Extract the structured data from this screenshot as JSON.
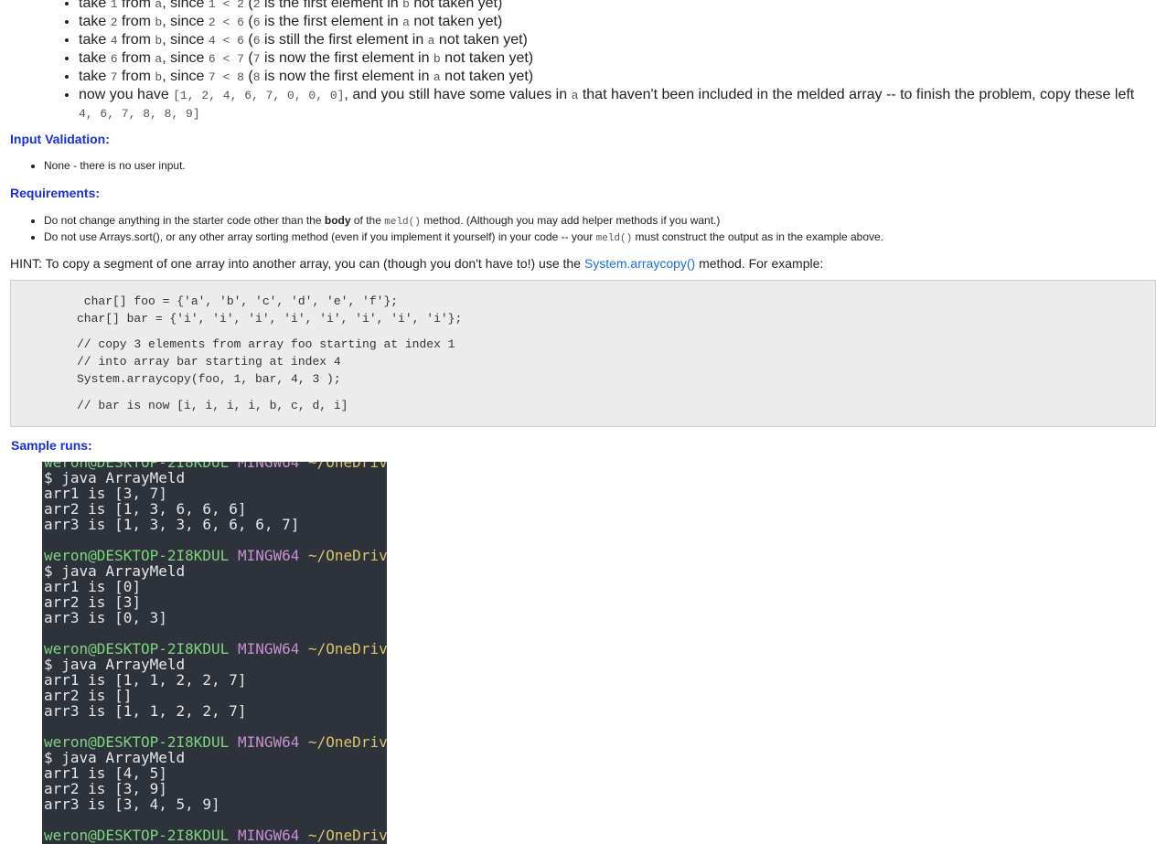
{
  "steps": [
    {
      "a": "take ",
      "c1": "1",
      "b": " from ",
      "c2": "a",
      "d": ", since ",
      "c3": "1 < 2",
      "e": " (",
      "c4": "2",
      "f": " is the first element in ",
      "c5": "b",
      "g": "  not taken yet)"
    },
    {
      "a": "take ",
      "c1": "2",
      "b": " from ",
      "c2": "b",
      "d": ", since ",
      "c3": "2 < 6",
      "e": " (",
      "c4": "6",
      "f": " is the first element in ",
      "c5": "a",
      "g": "  not taken yet)"
    },
    {
      "a": "take ",
      "c1": "4",
      "b": " from ",
      "c2": "b",
      "d": ", since ",
      "c3": "4 < 6",
      "e": " (",
      "c4": "6",
      "f": " is still the first element in ",
      "c5": "a",
      "g": " not taken yet)"
    },
    {
      "a": "take ",
      "c1": "6",
      "b": " from ",
      "c2": "a",
      "d": ", since ",
      "c3": "6 < 7",
      "e": " (",
      "c4": "7",
      "f": " is now the first element in ",
      "c5": "b",
      "g": "  not taken yet)"
    },
    {
      "a": "take ",
      "c1": "7",
      "b": " from ",
      "c2": "b",
      "d": ", since ",
      "c3": "7 < 8",
      "e": " (",
      "c4": "8",
      "f": " is now the first element in ",
      "c5": "a",
      "g": "  not taken yet)"
    }
  ],
  "final_step": {
    "a": "now you have ",
    "code1": "[1, 2, 4, 6, 7, 0, 0, 0]",
    "b": ", and you still have some values in ",
    "code2": "a",
    "c": "  that haven't been included in the melded array -- to finish the problem, copy these left",
    "code3": "4, 6, 7, 8, 8, 9]"
  },
  "input_validation": {
    "heading": "Input Validation:",
    "items": [
      "None - there is no user input."
    ]
  },
  "requirements": {
    "heading": "Requirements:",
    "item1": {
      "a": "Do not change anything in the starter code other than the ",
      "bold": "body",
      "b": " of the ",
      "code": "meld()",
      "c": " method. (Although you may add helper methods if you want.)"
    },
    "item2": {
      "a": "Do not use Arrays.sort(), or any other array sorting method (even if you implement it yourself) in your code -- your ",
      "code": "meld()",
      "b": " must construct the output as in the example above."
    }
  },
  "hint": {
    "a": "HINT: To copy a segment of one array into another array, you can (though you don't have to!) use the ",
    "link": "System.arraycopy()",
    "b": " method. For example:"
  },
  "code_example": [
    " char[] foo = {'a', 'b', 'c', 'd', 'e', 'f'};",
    "char[] bar = {'i', 'i', 'i', 'i', 'i', 'i', 'i', 'i'};",
    "// copy 3 elements from array foo starting at index 1",
    "// into array bar starting at index 4",
    "System.arraycopy(foo, 1, bar, 4, 3 );",
    "// bar is now [i, i, i, i, b, c, d, i]"
  ],
  "sample_runs": {
    "heading": "Sample runs:",
    "prompt_user": "weron@DESKTOP-2I8KDUL",
    "prompt_sys": "MINGW64",
    "prompt_path": "~/OneDrive",
    "command": "$ java ArrayMeld",
    "runs": [
      [
        "arr1 is [3, 7]",
        "arr2 is [1, 3, 6, 6, 6]",
        "arr3 is [1, 3, 3, 6, 6, 6, 7]"
      ],
      [
        "arr1 is [0]",
        "arr2 is [3]",
        "arr3 is [0, 3]"
      ],
      [
        "arr1 is [1, 1, 2, 2, 7]",
        "arr2 is []",
        "arr3 is [1, 1, 2, 2, 7]"
      ],
      [
        "arr1 is [4, 5]",
        "arr2 is [3, 9]",
        "arr3 is [3, 4, 5, 9]"
      ]
    ]
  },
  "colors": {
    "heading": "#1a2fd0",
    "link": "#1a6fd0",
    "terminal_bg": "#2d323b",
    "prompt_user": "#7fd47f",
    "prompt_sys": "#c88fd0",
    "prompt_path": "#d7c36a"
  }
}
